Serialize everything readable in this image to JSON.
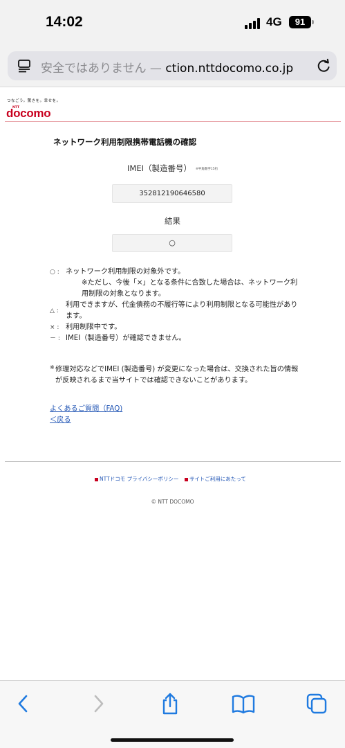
{
  "status_bar": {
    "time": "14:02",
    "network": "4G",
    "battery": "91"
  },
  "address_bar": {
    "security_label": "安全ではありません — ",
    "domain": "ction.nttdocomo.co.jp"
  },
  "brand": {
    "tagline": "つなごう。驚きを。幸せを。",
    "ntt": "NTT",
    "logo": "docomo"
  },
  "page": {
    "heading": "ネットワーク利用制限携帯電話機の確認",
    "imei_label": "IMEI（製造番号）",
    "imei_note": "※半角数字15桁",
    "imei_value": "352812190646580",
    "result_label": "結果",
    "result_value": "○"
  },
  "legend": [
    {
      "symbol": "○ :",
      "text": "ネットワーク利用制限の対象外です。",
      "sub": "※ただし、今後「×」となる条件に合致した場合は、ネットワーク利用制限の対象となります。"
    },
    {
      "symbol": "△ :",
      "text": "利用できますが、代金債務の不履行等により利用制限となる可能性があります。"
    },
    {
      "symbol": "× :",
      "text": "利用制限中です。"
    },
    {
      "symbol": "－ :",
      "text": "IMEI（製造番号）が確認できません。"
    }
  ],
  "note": {
    "mark": "※",
    "text": "修理対応などでIMEI (製造番号) が変更になった場合は、交換された旨の情報が反映されるまで当サイトでは確認できないことがあります。"
  },
  "links": {
    "faq": "よくあるご質問（FAQ)",
    "back": "＜戻る"
  },
  "footer": {
    "privacy": "NTTドコモ プライバシーポリシー",
    "terms": "サイトご利用にあたって",
    "copyright": "© NTT DOCOMO"
  },
  "toolbar": {
    "accent_color": "#1f7ae0",
    "disabled_color": "#bdbdbd",
    "icons": [
      "back-icon",
      "forward-icon",
      "share-icon",
      "bookmarks-icon",
      "tabs-icon"
    ]
  }
}
